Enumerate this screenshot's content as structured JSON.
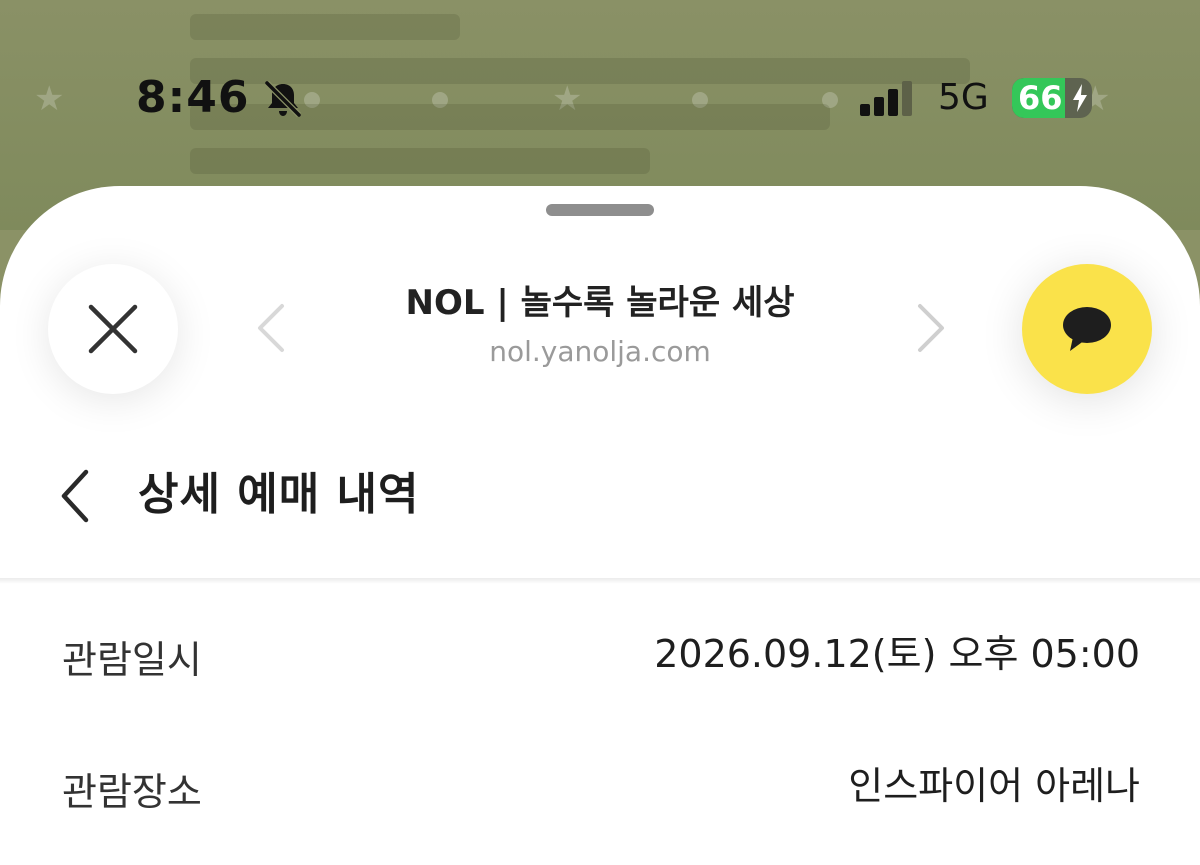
{
  "status_bar": {
    "time": "8:46",
    "network": "5G",
    "battery_level": 66,
    "battery_text": "66",
    "silent_icon": "bell-slash-icon",
    "signal_icon": "signal-bars-icon",
    "charging_icon": "bolt-icon"
  },
  "browser_header": {
    "title": "NOL | 놀수록 놀라운 세상",
    "url": "nol.yanolja.com",
    "close_icon": "close-icon",
    "prev_icon": "chevron-left-icon",
    "next_icon": "chevron-right-icon",
    "share_icon": "kakao-chat-icon",
    "share_color": "#fae24a"
  },
  "page": {
    "title": "상세 예매 내역",
    "back_icon": "chevron-left-icon"
  },
  "details": [
    {
      "label": "관람일시",
      "value": "2026.09.12(토) 오후 05:00"
    },
    {
      "label": "관람장소",
      "value": "인스파이어 아레나"
    }
  ]
}
